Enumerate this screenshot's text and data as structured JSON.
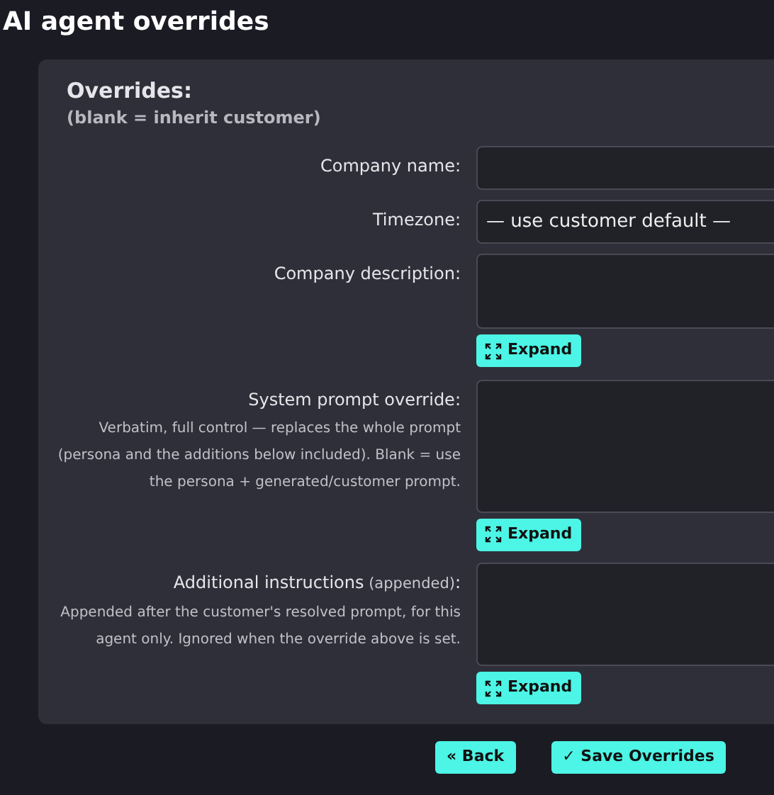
{
  "title": "AI agent overrides",
  "panel": {
    "heading": "Overrides:",
    "subheading": "(blank = inherit customer)",
    "fields": [
      {
        "kind": "input",
        "label": "Company name:"
      },
      {
        "kind": "select",
        "label": "Timezone:",
        "value": "— use customer default —"
      },
      {
        "kind": "textarea",
        "label": "Company description:",
        "button": "Expand"
      },
      {
        "kind": "textarea",
        "label": "System prompt override:",
        "help": "Verbatim, full control — replaces the whole prompt (persona and the additions below included). Blank = use the persona + generated/customer prompt.",
        "button": "Expand"
      },
      {
        "kind": "textarea",
        "label": "Additional instructions",
        "note": "(appended)",
        "suffix": ":",
        "help": "Appended after the customer's resolved prompt, for this agent only. Ignored when the override above is set.",
        "button": "Expand"
      }
    ]
  },
  "actions": [
    {
      "label": "« Back"
    },
    {
      "label": "✓ Save Overrides"
    }
  ]
}
